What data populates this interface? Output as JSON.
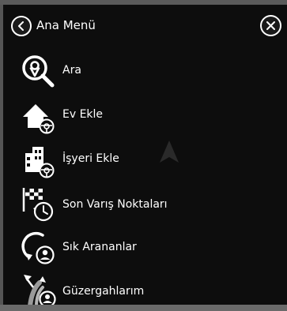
{
  "header": {
    "title": "Ana Menü"
  },
  "menu": {
    "items": [
      {
        "label": "Ara",
        "icon": "search-icon"
      },
      {
        "label": "Ev Ekle",
        "icon": "home-add-icon"
      },
      {
        "label": "İşyeri Ekle",
        "icon": "workplace-add-icon"
      },
      {
        "label": "Son Varış Noktaları",
        "icon": "recent-destinations-icon"
      },
      {
        "label": "Sık Arananlar",
        "icon": "frequent-searches-icon"
      },
      {
        "label": "Güzergahlarım",
        "icon": "my-routes-icon"
      }
    ]
  },
  "colors": {
    "panel_background": "#0d0d0d",
    "frame": "#555555",
    "text": "#ffffff",
    "map_pointer": "#2a2a2a"
  }
}
